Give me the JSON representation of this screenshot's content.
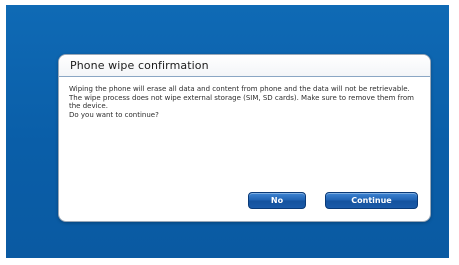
{
  "dialog": {
    "title": "Phone wipe confirmation",
    "message_lines": [
      "Wiping the phone will erase all data and content from phone and the data will not be retrievable.",
      "The wipe process does not wipe external storage (SIM, SD cards). Make sure to remove them from the device.",
      "Do you want to continue?"
    ],
    "buttons": {
      "no_label": "No",
      "continue_label": "Continue"
    }
  },
  "colors": {
    "background_blue": "#0a5ea8",
    "button_blue": "#1f62b2"
  }
}
